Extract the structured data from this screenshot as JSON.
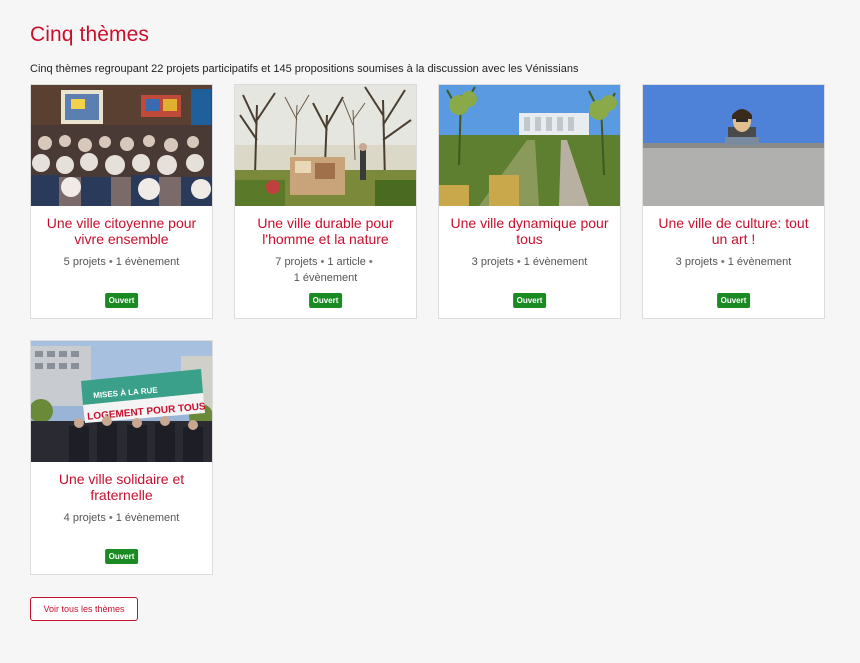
{
  "section": {
    "title": "Cinq thèmes",
    "subtitle": "Cinq thèmes regroupant 22 projets participatifs et 145 propositions soumises à la discussion avec les Vénissians"
  },
  "themes": [
    {
      "title": "Une ville citoyenne pour vivre ensemble",
      "meta": [
        "5 projets",
        "1 évènement"
      ],
      "badge": "Ouvert",
      "image": "conference-audience"
    },
    {
      "title": "Une ville durable pour l'homme et la nature",
      "meta": [
        "7 projets",
        "1 article",
        "1 évènement"
      ],
      "badge": "Ouvert",
      "image": "garden-trees"
    },
    {
      "title": "Une ville dynamique pour tous",
      "meta": [
        "3 projets",
        "1 évènement"
      ],
      "badge": "Ouvert",
      "image": "green-path"
    },
    {
      "title": "Une ville de culture: tout un art !",
      "meta": [
        "3 projets",
        "1 évènement"
      ],
      "badge": "Ouvert",
      "image": "statue-wall"
    },
    {
      "title": "Une ville solidaire et fraternelle",
      "meta": [
        "4 projets",
        "1 évènement"
      ],
      "badge": "Ouvert",
      "image": "demonstration-banner",
      "banner_text": [
        "MISES À LA RUE",
        "LOGEMENT POUR TOUS"
      ]
    }
  ],
  "all_button_label": "Voir tous les thèmes",
  "colors": {
    "accent": "#c8102e",
    "badge": "#1a8a23",
    "background": "#f6f6f6"
  }
}
